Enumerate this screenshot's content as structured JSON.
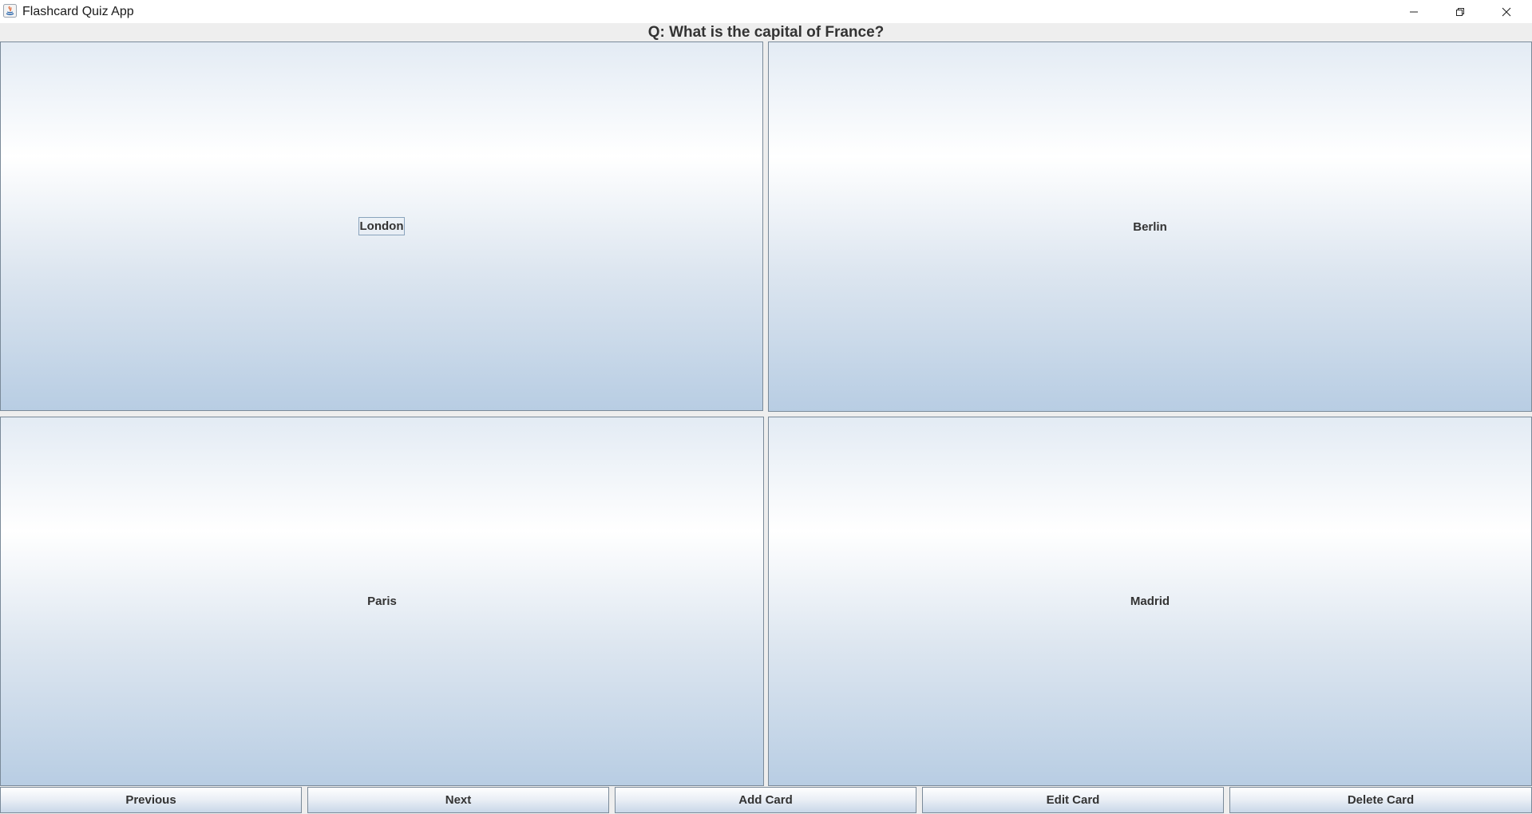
{
  "window": {
    "title": "Flashcard Quiz App",
    "controls": {
      "minimize": "minimize-icon",
      "maximize": "restore-icon",
      "close": "close-icon"
    }
  },
  "quiz": {
    "question": "Q: What is the capital of France?",
    "answers": [
      {
        "label": "London",
        "focused": true
      },
      {
        "label": "Berlin",
        "focused": false
      },
      {
        "label": "Paris",
        "focused": false
      },
      {
        "label": "Madrid",
        "focused": false
      }
    ]
  },
  "navigation": {
    "buttons": [
      "Previous",
      "Next",
      "Add Card",
      "Edit Card",
      "Delete Card"
    ]
  },
  "colors": {
    "gradient_top": "#e3ebf4",
    "gradient_mid": "#ffffff",
    "gradient_bottom": "#b8cde3",
    "border": "#7a8a99",
    "text": "#333333"
  }
}
